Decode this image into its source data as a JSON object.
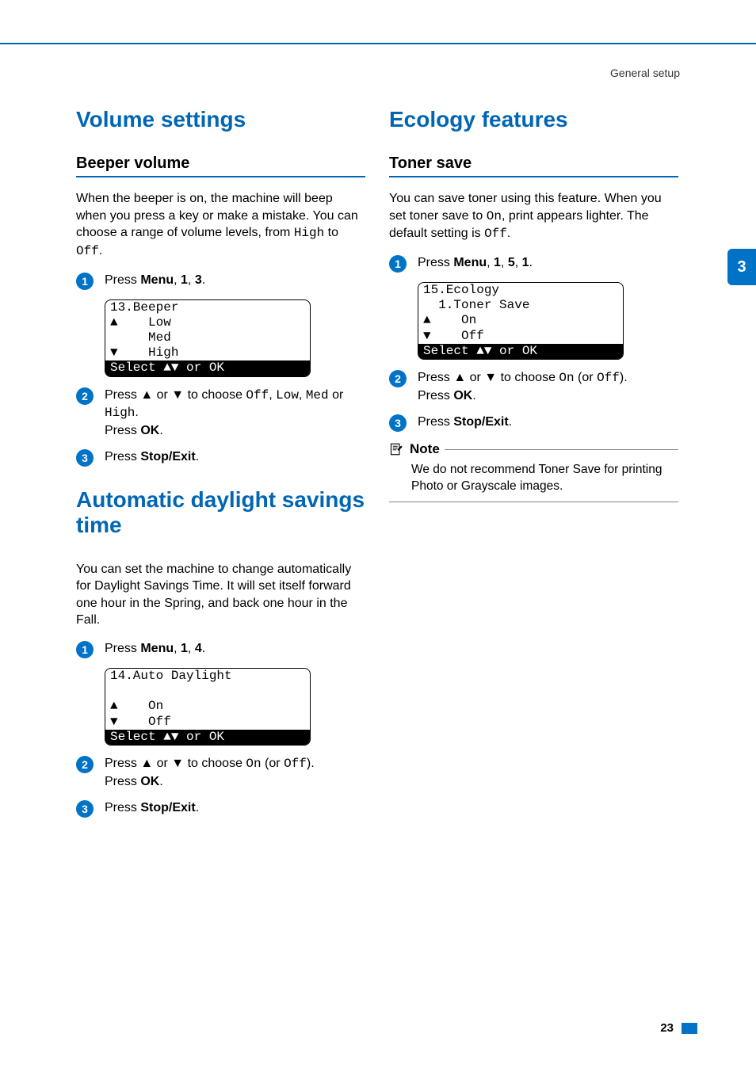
{
  "breadcrumb": "General setup",
  "side_tab": "3",
  "page_number": "23",
  "left": {
    "section1": {
      "heading": "Volume settings",
      "sub": "Beeper volume",
      "intro_pre": "When the beeper is on, the machine will beep when you press a key or make a mistake. You can choose a range of volume levels, from ",
      "intro_code1": "High",
      "intro_mid": " to ",
      "intro_code2": "Off",
      "intro_post": ".",
      "step1_pre": "Press ",
      "step1_b1": "Menu",
      "step1_mid1": ", ",
      "step1_b2": "1",
      "step1_mid2": ", ",
      "step1_b3": "3",
      "step1_post": ".",
      "lcd": {
        "l1": "13.Beeper",
        "l2": "▲    Low",
        "l3": "     Med",
        "l4": "▼    High",
        "l5": "Select ▲▼ or OK"
      },
      "step2_pre": "Press ▲ or ▼ to choose ",
      "step2_c1": "Off",
      "step2_m1": ", ",
      "step2_c2": "Low",
      "step2_m2": ", ",
      "step2_c3": "Med",
      "step2_m3": " or ",
      "step2_c4": "High",
      "step2_m4": ".",
      "step2_l2a": "Press ",
      "step2_l2b": "OK",
      "step2_l2c": ".",
      "step3_a": "Press ",
      "step3_b": "Stop/Exit",
      "step3_c": "."
    },
    "section2": {
      "heading": "Automatic daylight savings time",
      "intro": "You can set the machine to change automatically for Daylight Savings Time. It will set itself forward one hour in the Spring, and back one hour in the Fall.",
      "step1_pre": "Press ",
      "step1_b1": "Menu",
      "step1_mid1": ", ",
      "step1_b2": "1",
      "step1_mid2": ", ",
      "step1_b3": "4",
      "step1_post": ".",
      "lcd": {
        "l1": "14.Auto Daylight",
        "l2": " ",
        "l3": "▲    On",
        "l4": "▼    Off",
        "l5": "Select ▲▼ or OK"
      },
      "step2_pre": "Press ▲ or ▼ to choose ",
      "step2_c1": "On",
      "step2_m1": " (or ",
      "step2_c2": "Off",
      "step2_m2": ").",
      "step2_l2a": "Press ",
      "step2_l2b": "OK",
      "step2_l2c": ".",
      "step3_a": "Press ",
      "step3_b": "Stop/Exit",
      "step3_c": "."
    }
  },
  "right": {
    "section1": {
      "heading": "Ecology features",
      "sub": "Toner save",
      "intro_pre": "You can save toner using this feature. When you set toner save to ",
      "intro_c1": "On",
      "intro_mid": ", print appears lighter. The default setting is ",
      "intro_c2": "Off",
      "intro_post": ".",
      "step1_pre": "Press ",
      "step1_b1": "Menu",
      "step1_mid1": ", ",
      "step1_b2": "1",
      "step1_mid2": ", ",
      "step1_b3": "5",
      "step1_mid3": ", ",
      "step1_b4": "1",
      "step1_post": ".",
      "lcd": {
        "l1": "15.Ecology",
        "l2": "  1.Toner Save",
        "l3": "▲    On",
        "l4": "▼    Off",
        "l5": "Select ▲▼ or OK"
      },
      "step2_pre": "Press ▲ or ▼ to choose ",
      "step2_c1": "On",
      "step2_m1": " (or ",
      "step2_c2": "Off",
      "step2_m2": ").",
      "step2_l2a": "Press ",
      "step2_l2b": "OK",
      "step2_l2c": ".",
      "step3_a": "Press ",
      "step3_b": "Stop/Exit",
      "step3_c": ".",
      "note_title": "Note",
      "note_body": "We do not recommend Toner Save for printing Photo or Grayscale images."
    }
  }
}
